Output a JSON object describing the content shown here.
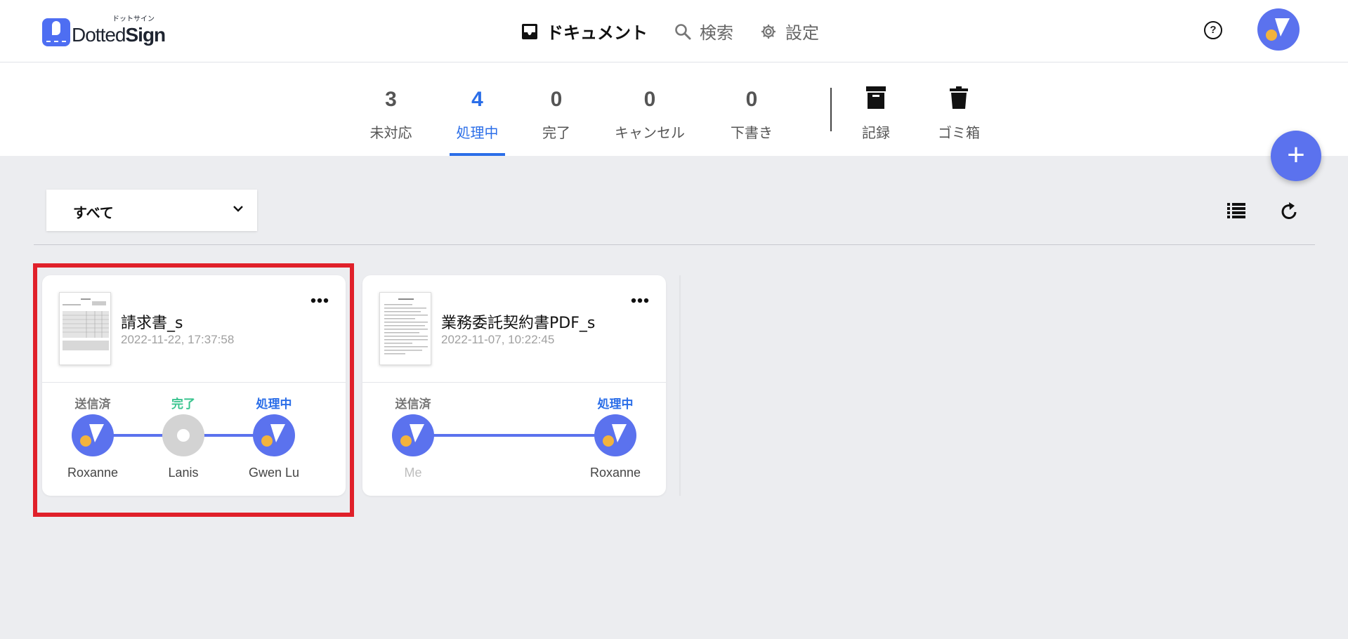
{
  "header": {
    "logo_text_a": "Dotted",
    "logo_text_b": "Sign",
    "logo_kana": "ドットサイン",
    "nav": [
      {
        "label": "ドキュメント",
        "icon": "inbox-icon",
        "active": true
      },
      {
        "label": "検索",
        "icon": "search-icon",
        "active": false
      },
      {
        "label": "設定",
        "icon": "gear-icon",
        "active": false
      }
    ],
    "help_glyph": "?"
  },
  "tabs": [
    {
      "count": "3",
      "label": "未対応"
    },
    {
      "count": "4",
      "label": "処理中",
      "active": true
    },
    {
      "count": "0",
      "label": "完了"
    },
    {
      "count": "0",
      "label": "キャンセル"
    },
    {
      "count": "0",
      "label": "下書き"
    }
  ],
  "tab_actions": [
    {
      "label": "記録",
      "icon": "archive-icon"
    },
    {
      "label": "ゴミ箱",
      "icon": "trash-icon"
    }
  ],
  "fab_glyph": "+",
  "filter": {
    "selected": "すべて"
  },
  "documents": [
    {
      "title": "請求書_s",
      "date": "2022-11-22, 17:37:58",
      "flow": [
        {
          "status": "送信済",
          "name": "Roxanne"
        },
        {
          "status": "完了",
          "name": "Lanis"
        },
        {
          "status": "処理中",
          "name": "Gwen Lu"
        }
      ]
    },
    {
      "title": "業務委託契約書PDF_s",
      "date": "2022-11-07, 10:22:45",
      "flow": [
        {
          "status": "送信済",
          "name": "Me"
        },
        {
          "status": "処理中",
          "name": "Roxanne"
        }
      ]
    }
  ],
  "colors": {
    "accent": "#5b72ee",
    "active_tab": "#2b6ee8",
    "done": "#3bc48f",
    "highlight": "#e0202a"
  }
}
